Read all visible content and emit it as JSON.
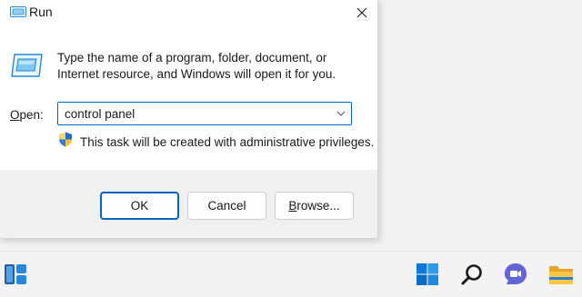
{
  "window": {
    "title": "Run",
    "description": "Type the name of a program, folder, document, or Internet resource, and Windows will open it for you.",
    "open_label_prefix": "O",
    "open_label_rest": "pen:",
    "open_value": "control panel",
    "admin_note": "This task will be created with administrative privileges."
  },
  "buttons": {
    "ok": "OK",
    "cancel": "Cancel",
    "browse_prefix": "B",
    "browse_rest": "rowse..."
  },
  "icons": {
    "title": "run-icon",
    "close": "close-icon",
    "dropdown": "chevron-down-icon",
    "shield": "uac-shield-icon"
  },
  "taskbar": {
    "items": [
      "widgets-icon",
      "start-icon",
      "search-icon",
      "chat-icon",
      "file-explorer-icon"
    ]
  },
  "colors": {
    "accent": "#0067c0",
    "footer": "#f0f0f0"
  }
}
